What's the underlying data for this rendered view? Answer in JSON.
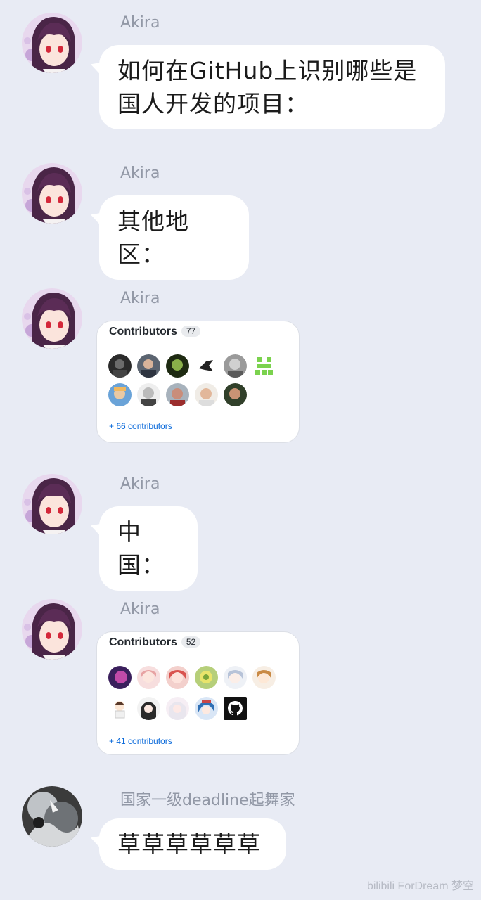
{
  "messages": [
    {
      "sender": "Akira",
      "text": "如何在GitHub上识别哪些是\n国人开发的项目："
    },
    {
      "sender": "Akira",
      "text": "其他地区："
    },
    {
      "sender": "Akira",
      "card": {
        "title": "Contributors",
        "count": "77",
        "more": "+ 66 contributors"
      }
    },
    {
      "sender": "Akira",
      "text": "中国："
    },
    {
      "sender": "Akira",
      "card": {
        "title": "Contributors",
        "count": "52",
        "more": "+ 41 contributors"
      }
    },
    {
      "sender": "国家一级deadline起舞家",
      "text": "草草草草草草"
    }
  ],
  "watermark": "bilibili ForDream  梦空",
  "colors": {
    "background": "#e8ebf4",
    "bubble": "#ffffff",
    "sender_name": "#9298a6",
    "link": "#0969da"
  },
  "icons": [
    "akira-avatar",
    "user-avatar",
    "github-octocat-icon",
    "identicon-icon"
  ]
}
